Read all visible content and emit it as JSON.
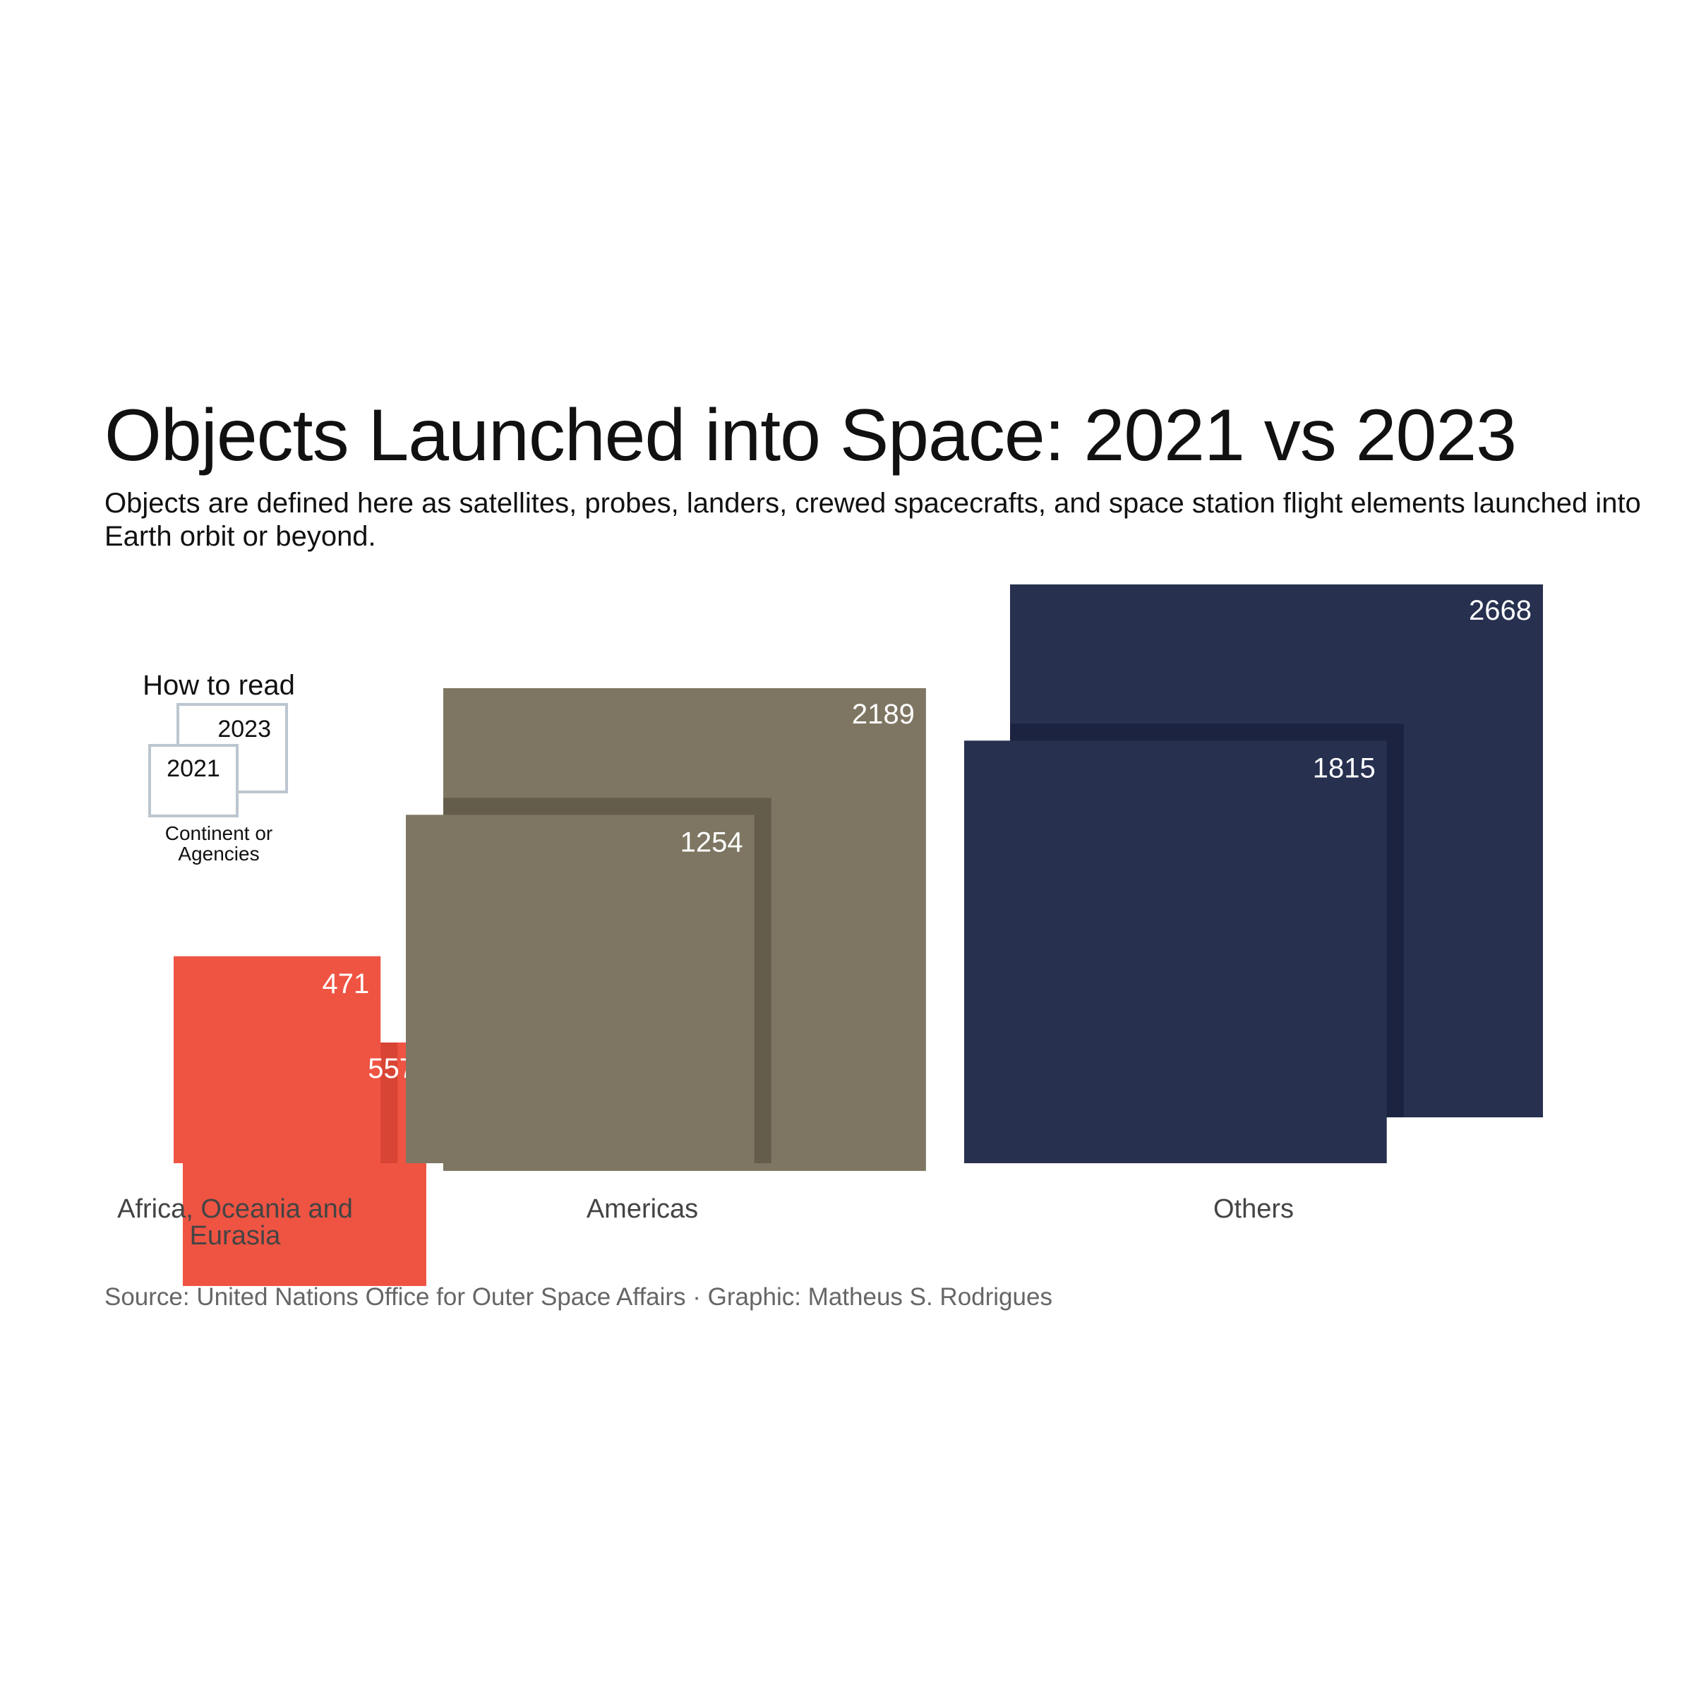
{
  "title": "Objects Launched into Space: 2021 vs 2023",
  "subtitle": "Objects are defined here as satellites, probes, landers, crewed spacecrafts, and space station flight elements launched into Earth orbit or beyond.",
  "source": "Source: United Nations Office for Outer Space Affairs · Graphic: Matheus S. Rodrigues",
  "legend": {
    "heading": "How to read",
    "back_label": "2023",
    "front_label": "2021",
    "caption_line1": "Continent or",
    "caption_line2": "Agencies"
  },
  "chart_data": {
    "type": "area",
    "encoding": "square area proportional to number of objects launched",
    "series": [
      {
        "name": "2021",
        "values": [
          471,
          1254,
          1815
        ]
      },
      {
        "name": "2023",
        "values": [
          557,
          2189,
          2668
        ]
      }
    ],
    "categories": [
      "Africa, Oceania and Eurasia",
      "Americas",
      "Others"
    ],
    "colors": {
      "Africa, Oceania and Eurasia": "#ef5443",
      "Americas": "#7e7662",
      "Others": "#27304f"
    },
    "overlap_colors": {
      "Africa, Oceania and Eurasia": "#d84534",
      "Americas": "#645d4c",
      "Others": "#1b2340"
    }
  }
}
